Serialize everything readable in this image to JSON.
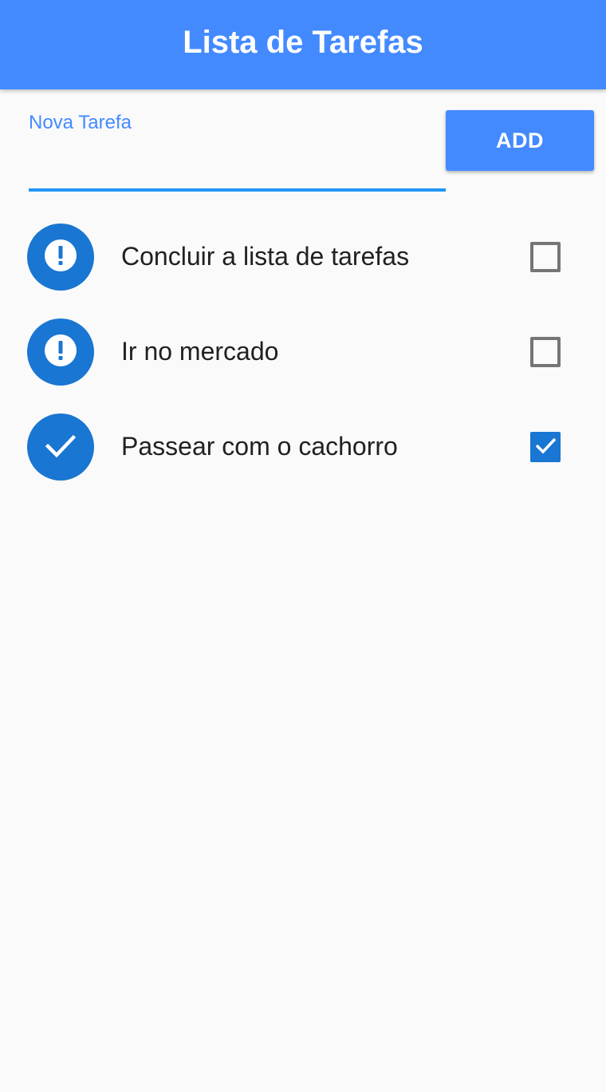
{
  "appbar": {
    "title": "Lista de Tarefas"
  },
  "new_task": {
    "label": "Nova Tarefa",
    "value": "",
    "add_label": "ADD"
  },
  "tasks": [
    {
      "label": "Concluir a lista de tarefas",
      "done": false,
      "icon": "error-icon"
    },
    {
      "label": "Ir no mercado",
      "done": false,
      "icon": "error-icon"
    },
    {
      "label": "Passear com o cachorro",
      "done": true,
      "icon": "check-icon"
    }
  ],
  "colors": {
    "primary": "#448aff",
    "avatar": "#1976d2",
    "underline": "#2196f3",
    "checkbox_checked": "#1976d2",
    "checkbox_unchecked": "#757575"
  }
}
